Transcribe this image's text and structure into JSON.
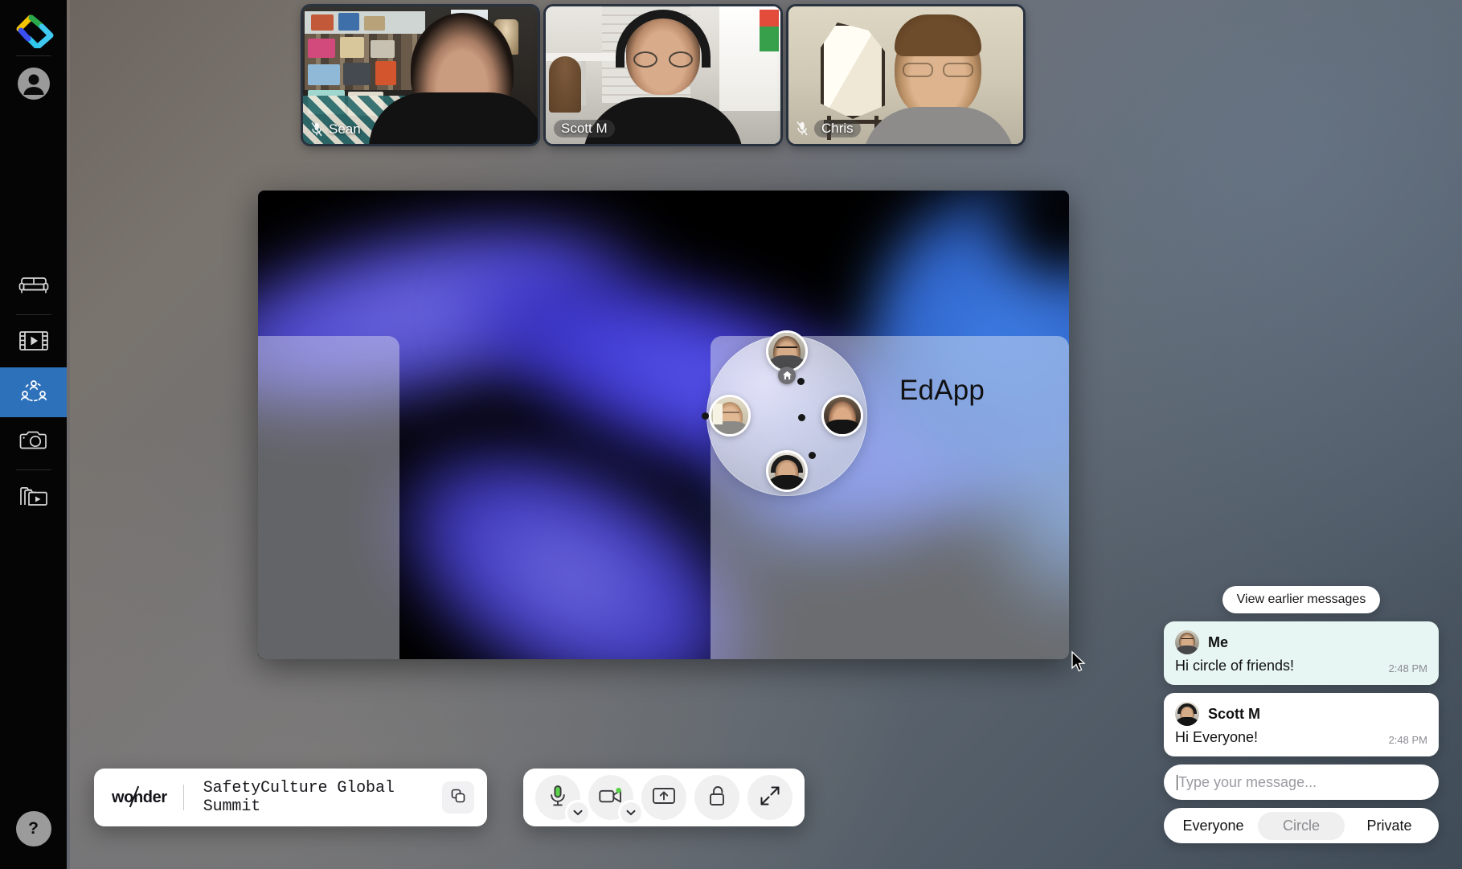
{
  "app": {
    "product": "wonder",
    "logo_icon": "wonder-logo-icon"
  },
  "sidebar": {
    "avatar_icon": "user-avatar-icon",
    "items": [
      {
        "id": "lounge",
        "label": "Lounge",
        "icon": "sofa-icon",
        "active": false
      },
      {
        "id": "media",
        "label": "Media",
        "icon": "film-strip-icon",
        "active": false
      },
      {
        "id": "circles",
        "label": "Circles",
        "icon": "people-circle-icon",
        "active": true
      },
      {
        "id": "snapshot",
        "label": "Snapshot",
        "icon": "camera-icon",
        "active": false
      },
      {
        "id": "library",
        "label": "Library",
        "icon": "folder-video-icon",
        "active": false
      }
    ],
    "help_label": "?"
  },
  "tiles": [
    {
      "name": "Sean",
      "muted": true,
      "chip": false
    },
    {
      "name": "Scott M",
      "muted": false,
      "chip": true
    },
    {
      "name": "Chris",
      "muted": true,
      "chip": true
    }
  ],
  "canvas": {
    "shared_app_title": "EdApp",
    "circle": {
      "members": [
        "scott-avatar",
        "chris-avatar",
        "sean-avatar",
        "guest-avatar"
      ],
      "home_icon": "home-icon",
      "empty_seats": 4
    }
  },
  "wonderbar": {
    "brand": "wonder",
    "meeting_name": "SafetyCulture Global Summit",
    "copy_icon": "copy-link-icon"
  },
  "controls": [
    {
      "id": "mic",
      "icon": "microphone-icon",
      "label": "Microphone",
      "has_caret": true,
      "live": true
    },
    {
      "id": "camera",
      "icon": "video-camera-icon",
      "label": "Camera",
      "has_caret": true,
      "live": true
    },
    {
      "id": "share",
      "icon": "screen-share-icon",
      "label": "Share screen",
      "has_caret": false,
      "live": false
    },
    {
      "id": "lock",
      "icon": "unlock-icon",
      "label": "Lock room",
      "has_caret": false,
      "live": false
    },
    {
      "id": "fullscreen",
      "icon": "expand-arrows-icon",
      "label": "Fullscreen",
      "has_caret": false,
      "live": false
    }
  ],
  "chat": {
    "view_earlier_label": "View earlier messages",
    "messages": [
      {
        "author": "Me",
        "text": "Hi circle of friends!",
        "time": "2:48 PM",
        "own": true
      },
      {
        "author": "Scott M",
        "text": "Hi Everyone!",
        "time": "2:48 PM",
        "own": false
      }
    ],
    "composer_placeholder": "Type your message...",
    "audience": {
      "options": [
        "Everyone",
        "Circle",
        "Private"
      ],
      "selected": "Circle"
    }
  },
  "colors": {
    "accent_blue": "#2d71ba",
    "own_message_bg": "#e7f6f2",
    "live_green": "#5bd14a",
    "panel_white": "#ffffff",
    "sidebar_black": "#050506"
  }
}
